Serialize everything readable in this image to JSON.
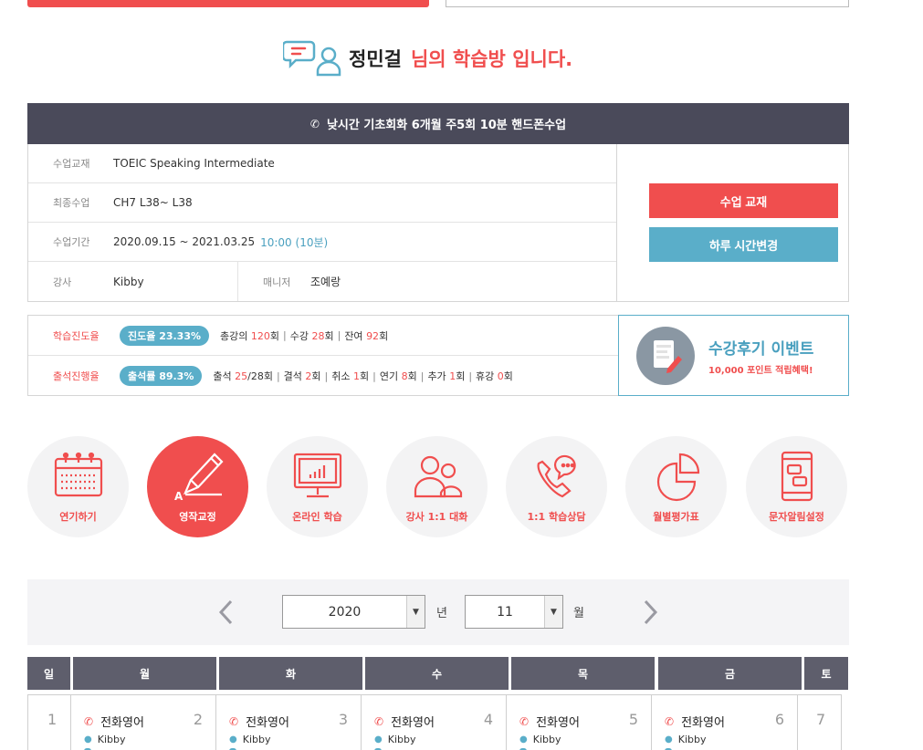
{
  "greeting": {
    "name": "정민걸",
    "suffix": "님의 학습방 입니다."
  },
  "course": {
    "title": "낮시간 기초회화 6개월 주5회 10분 핸드폰수업"
  },
  "info": {
    "textbook_label": "수업교재",
    "textbook_value": "TOEIC Speaking Intermediate",
    "last_label": "최종수업",
    "last_value": "CH7 L38~ L38",
    "period_label": "수업기간",
    "period_value": "2020.09.15 ~ 2021.03.25",
    "period_time": "10:00 (10분)",
    "teacher_label": "강사",
    "teacher_value": "Kibby",
    "manager_label": "매니저",
    "manager_value": "조예랑"
  },
  "buttons": {
    "textbook": "수업 교재",
    "change_time": "하루 시간변경"
  },
  "progress": {
    "study_label": "학습진도율",
    "study_pill": "진도율 23.33%",
    "study_total_pre": "총강의 ",
    "study_total": "120",
    "study_total_suf": "회",
    "study_done_pre": "수강 ",
    "study_done": "28",
    "study_done_suf": "회",
    "study_left_pre": "잔여 ",
    "study_left": "92",
    "study_left_suf": "회",
    "attend_label": "출석진행율",
    "attend_pill": "출석률 89.3%",
    "a1_pre": "출석 ",
    "a1": "25",
    "a1_suf": "/28회",
    "a2_pre": "결석 ",
    "a2": "2",
    "a2_suf": "회",
    "a3_pre": "취소 ",
    "a3": "1",
    "a3_suf": "회",
    "a4_pre": "연기 ",
    "a4": "8",
    "a4_suf": "회",
    "a5_pre": "추가 ",
    "a5": "1",
    "a5_suf": "회",
    "a6_pre": "휴강 ",
    "a6": "0",
    "a6_suf": "회",
    "separator": "|"
  },
  "event": {
    "title": "수강후기 이벤트",
    "sub": "10,000 포인트 적립혜택!"
  },
  "menu": [
    {
      "label": "연기하기",
      "icon": "calendar-icon"
    },
    {
      "label": "영작교정",
      "icon": "pencil-icon"
    },
    {
      "label": "온라인 학습",
      "icon": "monitor-chart-icon"
    },
    {
      "label": "강사 1:1 대화",
      "icon": "people-icon"
    },
    {
      "label": "1:1 학습상담",
      "icon": "phone-chat-icon"
    },
    {
      "label": "월별평가표",
      "icon": "pie-chart-icon"
    },
    {
      "label": "문자알림설정",
      "icon": "mobile-message-icon"
    }
  ],
  "date_select": {
    "year": "2020",
    "year_unit": "년",
    "month": "11",
    "month_unit": "월"
  },
  "calendar": {
    "days": [
      "일",
      "월",
      "화",
      "수",
      "목",
      "금",
      "토"
    ],
    "cells": [
      {
        "day": "1"
      },
      {
        "day": "2",
        "lesson": "전화영어",
        "teacher": "Kibby"
      },
      {
        "day": "3",
        "lesson": "전화영어",
        "teacher": "Kibby"
      },
      {
        "day": "4",
        "lesson": "전화영어",
        "teacher": "Kibby"
      },
      {
        "day": "5",
        "lesson": "전화영어",
        "teacher": "Kibby"
      },
      {
        "day": "6",
        "lesson": "전화영어",
        "teacher": "Kibby"
      },
      {
        "day": "7"
      }
    ]
  },
  "colors": {
    "accent_red": "#f04e4e",
    "accent_blue": "#5aaec9",
    "header_dark": "#4a4a5a"
  }
}
